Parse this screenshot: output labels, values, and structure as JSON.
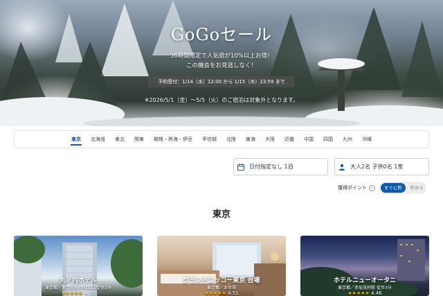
{
  "hero": {
    "title": "GoGoセール",
    "subtitle_line1": "36時間限定で人気宿が10%以上お得！",
    "subtitle_line2": "この機会をお見逃しなく！",
    "booking_period": "予約受付：1/14（水）12:00 から 1/15（木）23:59 まで",
    "exclusion_note": "※2026/5/1（金）～5/5（火）のご宿泊は対象外となります。"
  },
  "regions": {
    "tabs": [
      "東京",
      "北海道",
      "東北",
      "関東",
      "箱根・熱海・伊豆",
      "甲信越",
      "北陸",
      "東海",
      "大阪",
      "近畿",
      "中国",
      "四国",
      "九州",
      "沖縄"
    ],
    "active_index": 0
  },
  "search": {
    "date_label": "日付指定なし 1泊",
    "guests_label": "大人2名 子供0名 1室"
  },
  "points": {
    "label": "獲得ポイント",
    "info_icon": "ⓘ",
    "toggle_on": "すぐに貯",
    "toggle_off": "貯める"
  },
  "section": {
    "title": "東京"
  },
  "hotels": [
    {
      "name": "丸ノ内ホテル",
      "location": "東京都／東京駅丸の内北口 徒歩1分",
      "rating": "4.55"
    },
    {
      "name": "グランドニッコー東京 台場",
      "location": "東京都／お台場",
      "rating": "4.51"
    },
    {
      "name": "ホテルニューオータニ",
      "location": "東京都／赤坂見附駅 徒歩3分",
      "rating": "4.46"
    }
  ],
  "colors": {
    "accent": "#0a5aa8",
    "star": "#f5b400"
  }
}
